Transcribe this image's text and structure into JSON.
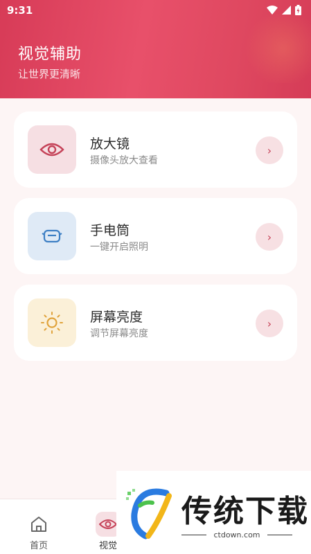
{
  "status_bar": {
    "time": "9:31"
  },
  "header": {
    "title": "视觉辅助",
    "subtitle": "让世界更清晰"
  },
  "features": [
    {
      "title": "放大镜",
      "desc": "摄像头放大查看",
      "icon": "eye-icon",
      "icon_bg": "#f6dfe3",
      "icon_color": "#c54258",
      "arrow": "›"
    },
    {
      "title": "手电筒",
      "desc": "一键开启照明",
      "icon": "flashlight-icon",
      "icon_bg": "#dfeaf6",
      "icon_color": "#3d7fc4",
      "arrow": "›"
    },
    {
      "title": "屏幕亮度",
      "desc": "调节屏幕亮度",
      "icon": "sun-icon",
      "icon_bg": "#fbf0d8",
      "icon_color": "#e0a23a",
      "arrow": "›"
    }
  ],
  "bottom_nav": [
    {
      "label": "首页",
      "icon": "home-icon"
    },
    {
      "label": "视觉",
      "icon": "eye-icon"
    }
  ],
  "watermark": {
    "text": "传统下载",
    "url": "ctdown.com"
  },
  "colors": {
    "accent": "#d93f5a",
    "background": "#fdf5f5"
  }
}
